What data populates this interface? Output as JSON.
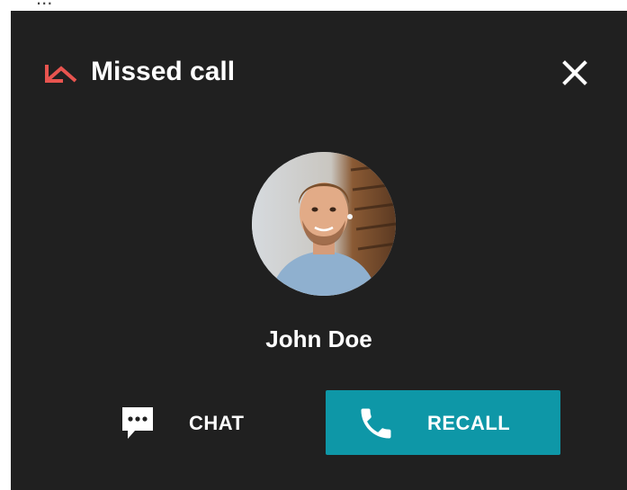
{
  "page_top_fragment": "...",
  "dialog": {
    "title": "Missed call",
    "title_icon": "missed-call-icon",
    "close_icon": "close-icon",
    "accent_color": "#e8544f"
  },
  "contact": {
    "name": "John Doe",
    "avatar": "contact-avatar-photo"
  },
  "actions": {
    "chat": {
      "label": "CHAT",
      "icon": "chat-bubble-icon"
    },
    "recall": {
      "label": "RECALL",
      "icon": "phone-icon",
      "color": "#0e97a7"
    }
  }
}
